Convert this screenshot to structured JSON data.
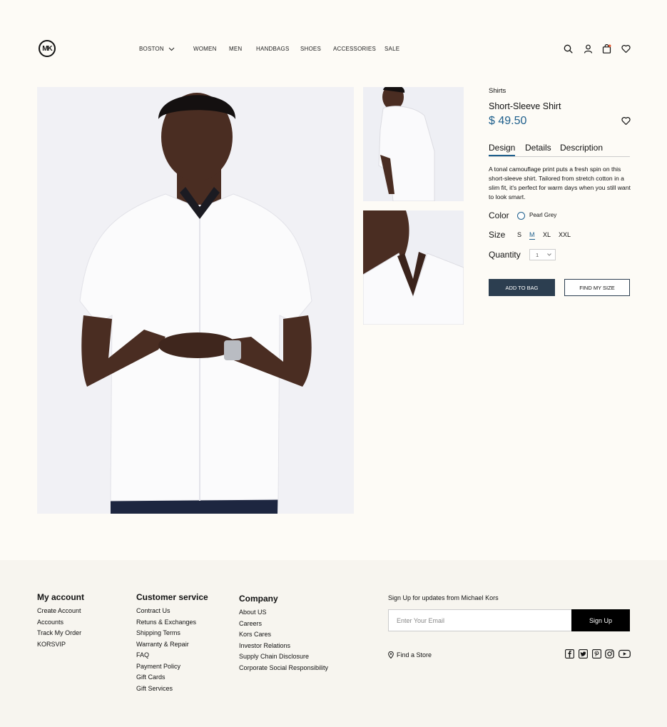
{
  "header": {
    "logo_text": "MK",
    "city": "BOSTON",
    "nav": [
      "WOMEN",
      "MEN",
      "HANDBAGS",
      "SHOES",
      "ACCESSORIES",
      "SALE"
    ],
    "icons": [
      "search-icon",
      "account-icon",
      "bag-icon",
      "heart-icon"
    ]
  },
  "product": {
    "category": "Shirts",
    "name": "Short-Sleeve Shirt",
    "price": "$ 49.50",
    "tabs": [
      "Design",
      "Details",
      "Description"
    ],
    "active_tab": "Design",
    "description": "A tonal camouflage print puts a fresh spin on this short-sleeve shirt. Tailored from stretch cotton in a slim fit, it's perfect for warm days when you still want to look smart.",
    "color_label": "Color",
    "color_value": "Pearl Grey",
    "size_label": "Size",
    "sizes": [
      "S",
      "M",
      "XL",
      "XXL"
    ],
    "selected_size": "M",
    "quantity_label": "Quantity",
    "quantity_value": "1",
    "add_to_bag": "ADD TO BAG",
    "find_my_size": "FIND MY SIZE"
  },
  "footer": {
    "my_account": {
      "title": "My account",
      "links": [
        "Create Account",
        "Accounts",
        "Track My Order",
        "KORSVIP"
      ]
    },
    "customer_service": {
      "title": "Customer service",
      "links": [
        "Contract Us",
        "Retuns & Exchanges",
        "Shipping Terms",
        "Warranty & Repair",
        "FAQ",
        "Payment Policy",
        "Gift Cards",
        "Gift Services"
      ]
    },
    "company": {
      "title": "Company",
      "links": [
        "About US",
        "Careers",
        "Kors Cares",
        "Investor Relations",
        "Supply Chain Disclosure",
        "Corporate Social Responsibility"
      ]
    },
    "signup_title": "Sign Up for updates from Michael Kors",
    "email_placeholder": "Enter Your Email",
    "signup_button": "Sign Up",
    "find_store": "Find a Store",
    "social_icons": [
      "facebook-icon",
      "twitter-icon",
      "pinterest-icon",
      "instagram-icon",
      "youtube-icon"
    ]
  },
  "colors": {
    "accent": "#1e5f8c",
    "button_dark": "#2c3e50",
    "page_bg": "#fdfbf6",
    "footer_bg": "#f7f5ef"
  }
}
